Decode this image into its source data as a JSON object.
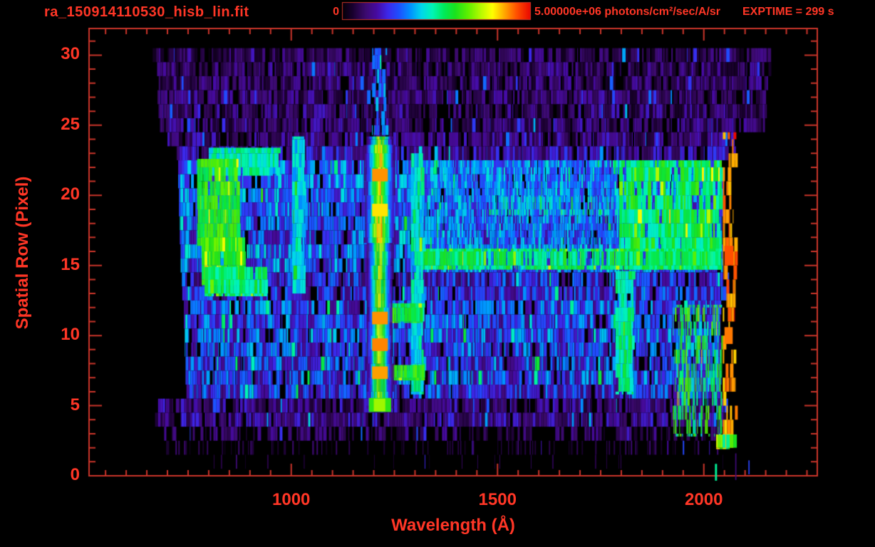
{
  "window": {
    "bg": "#000000",
    "accent": "#ff3626",
    "axis_color": "#c9342a"
  },
  "header": {
    "filename": "ra_150914110530_hisb_lin.fit",
    "colorbar": {
      "min_label": "0",
      "max_label": "5.00000e+06 photons/cm²/sec/A/sr"
    },
    "exptime_label": "EXPTIME = 299 s"
  },
  "chart_data": {
    "type": "heatmap",
    "title": "ra_150914110530_hisb_lin.fit",
    "xlabel": "Wavelength (Å)",
    "ylabel": "Spatial Row (Pixel)",
    "xlim": [
      510,
      2275
    ],
    "ylim": [
      0,
      31.9
    ],
    "xticks": [
      {
        "value": 1000,
        "label": "1000"
      },
      {
        "value": 1500,
        "label": "1500"
      },
      {
        "value": 2000,
        "label": "2000"
      }
    ],
    "yticks": [
      {
        "value": 0,
        "label": "0"
      },
      {
        "value": 5,
        "label": "5"
      },
      {
        "value": 10,
        "label": "10"
      },
      {
        "value": 15,
        "label": "15"
      },
      {
        "value": 20,
        "label": "20"
      },
      {
        "value": 25,
        "label": "25"
      },
      {
        "value": 30,
        "label": "30"
      }
    ],
    "x_minor_step": 50,
    "y_minor_step": 1,
    "grid": false,
    "colorbar": {
      "min": 0,
      "max": 5000000,
      "units": "photons/cm²/sec/A/sr"
    },
    "exptime_s": 299,
    "colormap_stops": [
      [
        0.0,
        5,
        0,
        10
      ],
      [
        0.05,
        25,
        0,
        45
      ],
      [
        0.12,
        60,
        10,
        110
      ],
      [
        0.18,
        70,
        10,
        160
      ],
      [
        0.24,
        60,
        40,
        235
      ],
      [
        0.3,
        30,
        80,
        255
      ],
      [
        0.36,
        0,
        145,
        255
      ],
      [
        0.42,
        0,
        215,
        235
      ],
      [
        0.48,
        0,
        245,
        180
      ],
      [
        0.54,
        0,
        235,
        90
      ],
      [
        0.6,
        25,
        225,
        30
      ],
      [
        0.67,
        95,
        240,
        0
      ],
      [
        0.74,
        185,
        250,
        0
      ],
      [
        0.8,
        255,
        255,
        0
      ],
      [
        0.87,
        255,
        160,
        0
      ],
      [
        0.93,
        255,
        80,
        0
      ],
      [
        1.0,
        235,
        10,
        0
      ]
    ],
    "noise_rows": [
      [
        30,
        664,
        2160,
        0.1,
        0.07,
        0.78
      ],
      [
        29,
        668,
        2160,
        0.11,
        0.08,
        0.85
      ],
      [
        28,
        672,
        2155,
        0.11,
        0.08,
        0.85
      ],
      [
        27,
        676,
        2150,
        0.12,
        0.08,
        0.85
      ],
      [
        26,
        678,
        2150,
        0.12,
        0.09,
        0.85
      ],
      [
        25,
        682,
        2145,
        0.13,
        0.09,
        0.85
      ],
      [
        24,
        700,
        2076,
        0.13,
        0.09,
        0.88
      ],
      [
        23,
        722,
        2076,
        0.17,
        0.1,
        0.9
      ],
      [
        22,
        726,
        2044,
        0.3,
        0.12,
        0.95
      ],
      [
        21,
        726,
        2044,
        0.32,
        0.12,
        0.95
      ],
      [
        20,
        728,
        2044,
        0.33,
        0.12,
        0.95
      ],
      [
        19,
        728,
        2044,
        0.3,
        0.12,
        0.95
      ],
      [
        18,
        730,
        2044,
        0.29,
        0.12,
        0.95
      ],
      [
        17,
        730,
        2044,
        0.28,
        0.12,
        0.95
      ],
      [
        16,
        732,
        2044,
        0.33,
        0.13,
        0.95
      ],
      [
        15,
        732,
        2044,
        0.3,
        0.12,
        0.95
      ],
      [
        14,
        735,
        2060,
        0.22,
        0.12,
        0.9
      ],
      [
        13,
        736,
        2060,
        0.24,
        0.12,
        0.9
      ],
      [
        12,
        740,
        2040,
        0.27,
        0.13,
        0.92
      ],
      [
        11,
        740,
        2040,
        0.27,
        0.13,
        0.92
      ],
      [
        10,
        742,
        2040,
        0.28,
        0.13,
        0.92
      ],
      [
        9,
        742,
        2040,
        0.27,
        0.13,
        0.92
      ],
      [
        8,
        744,
        2040,
        0.26,
        0.13,
        0.92
      ],
      [
        7,
        744,
        2040,
        0.27,
        0.13,
        0.92
      ],
      [
        6,
        746,
        2040,
        0.25,
        0.12,
        0.9
      ],
      [
        5,
        672,
        2052,
        0.14,
        0.09,
        0.85
      ],
      [
        4,
        670,
        2052,
        0.15,
        0.09,
        0.9
      ],
      [
        3,
        680,
        2050,
        0.11,
        0.07,
        0.5
      ],
      [
        2,
        690,
        2035,
        0.08,
        0.05,
        0.18
      ],
      [
        1,
        800,
        2050,
        0.08,
        0.05,
        0.05
      ]
    ],
    "features": [
      {
        "name": "upper-lya-trace",
        "type": "stripes",
        "rows": [
          24.3,
          30.5
        ],
        "lam": [
          1196,
          1230
        ],
        "v": 0.33,
        "var": 0.08,
        "density": 0.5
      },
      {
        "name": "continuum-left-cyan",
        "type": "stripes",
        "rows": [
          14.8,
          22.5
        ],
        "lam": [
          1330,
          1795
        ],
        "v": 0.36,
        "var": 0.1,
        "density": 0.45
      },
      {
        "name": "continuum-green-band",
        "type": "stripes",
        "rows": [
          14.7,
          22.5
        ],
        "lam": [
          1795,
          2042
        ],
        "v": 0.55,
        "var": 0.1,
        "density": 0.85
      },
      {
        "name": "bright-green-row-15",
        "type": "stripes",
        "rows": [
          14.7,
          16.2
        ],
        "lam": [
          1310,
          2042
        ],
        "v": 0.54,
        "var": 0.08,
        "density": 0.88
      },
      {
        "name": "green-row-19",
        "type": "stripes",
        "rows": [
          18.6,
          19.9
        ],
        "lam": [
          1480,
          1800
        ],
        "v": 0.45,
        "var": 0.1,
        "density": 0.45
      },
      {
        "name": "arc-top-arm",
        "type": "stripes",
        "rows": [
          21.4,
          23.4
        ],
        "lam": [
          800,
          968
        ],
        "v": 0.47,
        "var": 0.08,
        "density": 0.95
      },
      {
        "name": "arc-spine",
        "type": "stripes",
        "rows": [
          16.4,
          22.6
        ],
        "lam": [
          772,
          870
        ],
        "v": 0.6,
        "var": 0.07,
        "density": 0.97
      },
      {
        "name": "arc-spine-lower",
        "type": "stripes",
        "rows": [
          13.6,
          17.0
        ],
        "lam": [
          783,
          888
        ],
        "v": 0.62,
        "var": 0.07,
        "density": 0.97
      },
      {
        "name": "arc-bottom-arm",
        "type": "stripes",
        "rows": [
          12.8,
          14.9
        ],
        "lam": [
          790,
          938
        ],
        "v": 0.52,
        "var": 0.08,
        "density": 0.95
      },
      {
        "name": "lyb-column",
        "type": "stripes",
        "rows": [
          13.0,
          24.2
        ],
        "lam": [
          1002,
          1030
        ],
        "v": 0.42,
        "var": 0.07,
        "density": 0.95
      },
      {
        "name": "oi-column",
        "type": "stripes",
        "rows": [
          5.8,
          23.0
        ],
        "lam": [
          1290,
          1318
        ],
        "v": 0.46,
        "var": 0.09,
        "density": 0.95
      },
      {
        "name": "oi-rung-upper",
        "type": "stripes",
        "rows": [
          10.9,
          12.3
        ],
        "lam": [
          1236,
          1318
        ],
        "v": 0.58,
        "var": 0.07,
        "density": 0.95
      },
      {
        "name": "oi-rung-lower",
        "type": "stripes",
        "rows": [
          6.8,
          7.9
        ],
        "lam": [
          1236,
          1318
        ],
        "v": 0.6,
        "var": 0.07,
        "density": 0.95
      },
      {
        "name": "lya-column",
        "type": "column",
        "rows": [
          4.8,
          24.2
        ],
        "lam": [
          1176,
          1250
        ],
        "center": 1213,
        "sigma": 17,
        "peak": 0.68
      },
      {
        "name": "lya-bright-upper",
        "type": "column",
        "rows": [
          16.6,
          23.6
        ],
        "lam": [
          1176,
          1250
        ],
        "center": 1213,
        "sigma": 19,
        "peak": 0.78
      },
      {
        "name": "lya-hotspot-1",
        "type": "blob",
        "rows": [
          21.0,
          21.9
        ],
        "lam": [
          1196,
          1234
        ],
        "v": 0.88
      },
      {
        "name": "lya-hotspot-2",
        "type": "blob",
        "rows": [
          18.5,
          19.4
        ],
        "lam": [
          1196,
          1234
        ],
        "v": 0.82
      },
      {
        "name": "lya-hotspot-3",
        "type": "blob",
        "rows": [
          10.8,
          11.7
        ],
        "lam": [
          1196,
          1234
        ],
        "v": 0.88
      },
      {
        "name": "lya-hotspot-4",
        "type": "blob",
        "rows": [
          8.9,
          9.8
        ],
        "lam": [
          1196,
          1234
        ],
        "v": 0.89
      },
      {
        "name": "lya-hotspot-5",
        "type": "blob",
        "rows": [
          6.9,
          7.8
        ],
        "lam": [
          1196,
          1234
        ],
        "v": 0.87
      },
      {
        "name": "lya-foot",
        "type": "blob",
        "rows": [
          4.55,
          5.55
        ],
        "lam": [
          1188,
          1242
        ],
        "v": 0.62
      },
      {
        "name": "lya-foot-core",
        "type": "blob",
        "rows": [
          4.6,
          5.5
        ],
        "lam": [
          1200,
          1228
        ],
        "v": 0.72
      },
      {
        "name": "cyan-column-1800",
        "type": "stripes",
        "rows": [
          5.8,
          14.6
        ],
        "lam": [
          1786,
          1826
        ],
        "v": 0.5,
        "var": 0.08,
        "density": 0.9
      },
      {
        "name": "green-cluster-right",
        "type": "stripes",
        "rows": [
          2.8,
          12.2
        ],
        "lam": [
          1925,
          2044
        ],
        "v": 0.55,
        "var": 0.13,
        "density": 0.45
      },
      {
        "name": "red-edge",
        "type": "stripes",
        "rows": [
          2.0,
          24.5
        ],
        "lam": [
          2046,
          2076
        ],
        "v": 0.88,
        "var": 0.06,
        "density": 0.5
      },
      {
        "name": "red-edge-blob-1",
        "type": "blob",
        "rows": [
          15.0,
          16.4
        ],
        "lam": [
          2050,
          2072
        ],
        "v": 0.93
      },
      {
        "name": "red-edge-blob-2",
        "type": "blob",
        "rows": [
          9.4,
          10.6
        ],
        "lam": [
          2050,
          2070
        ],
        "v": 0.9
      },
      {
        "name": "red-edge-blob-3",
        "type": "blob",
        "rows": [
          2.0,
          3.0
        ],
        "lam": [
          2046,
          2072
        ],
        "v": 0.85
      },
      {
        "name": "row2-hot",
        "type": "stripes",
        "rows": [
          1.9,
          2.95
        ],
        "lam": [
          2030,
          2072
        ],
        "v": 0.65,
        "var": 0.18,
        "density": 0.7
      }
    ],
    "overlay_features": [
      {
        "name": "stray-green",
        "type": "blob",
        "rows": [
          -0.35,
          0.85
        ],
        "lam": [
          2027,
          2032
        ],
        "v": 0.5
      },
      {
        "name": "stray-purple",
        "type": "blob",
        "rows": [
          -0.3,
          1.6
        ],
        "lam": [
          2076,
          2079
        ],
        "v": 0.13
      },
      {
        "name": "stray-blue",
        "type": "blob",
        "rows": [
          0.1,
          1.1
        ],
        "lam": [
          2108,
          2111
        ],
        "v": 0.28
      }
    ]
  }
}
